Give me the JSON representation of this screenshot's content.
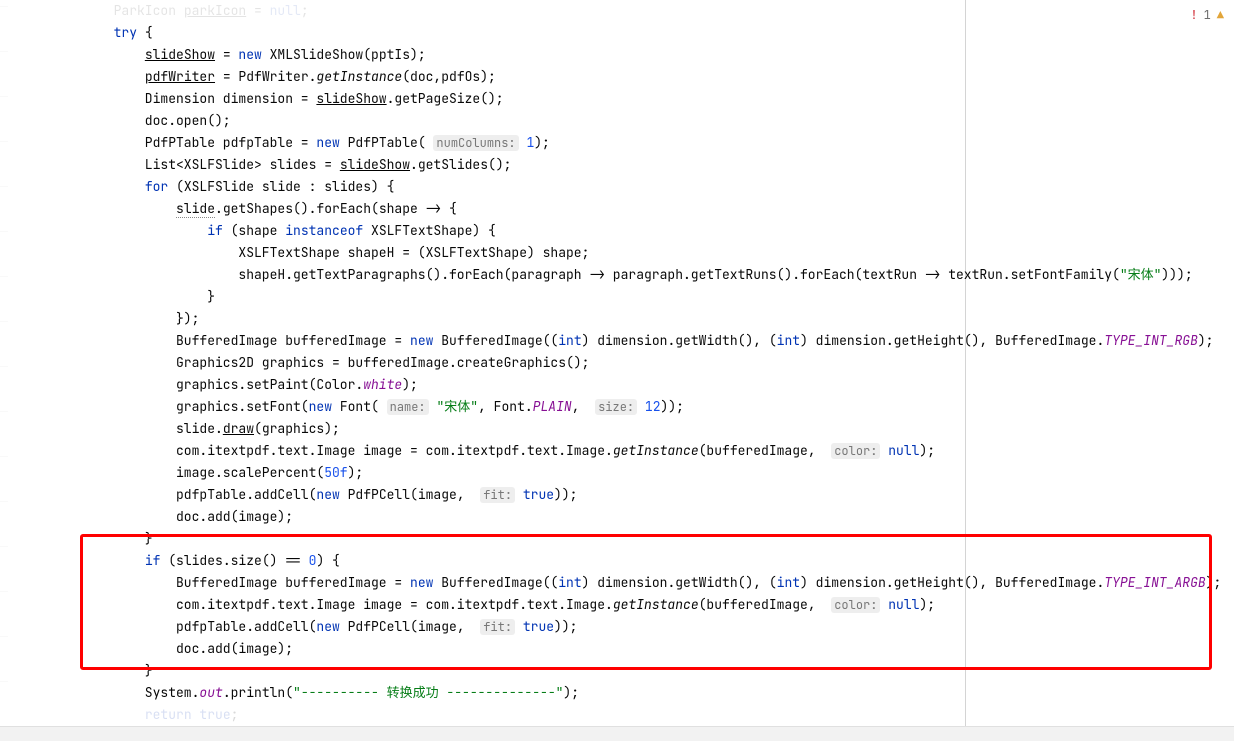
{
  "status": {
    "error_symbol": "!",
    "error_count": "1",
    "warn_symbol": "▲"
  },
  "code": {
    "l0a": "            ParkIcon ",
    "l0b": "parkIcon",
    "l0c": " = ",
    "l0d": "null",
    "l0e": ";",
    "l1a": "            ",
    "l1b": "try",
    "l1c": " {",
    "l2a": "                ",
    "l2b": "slideShow",
    "l2c": " = ",
    "l2d": "new",
    "l2e": " XMLSlideShow(pptIs);",
    "l3a": "                ",
    "l3b": "pdfWriter",
    "l3c": " = PdfWriter.",
    "l3d": "getInstance",
    "l3e": "(doc,pdfOs);",
    "l4a": "                Dimension dimension = ",
    "l4b": "slideShow",
    "l4c": ".getPageSize();",
    "l5a": "                doc.open();",
    "l6a": "                PdfPTable pdfpTable = ",
    "l6b": "new",
    "l6c": " PdfPTable( ",
    "l6d": "numColumns:",
    "l6e": " ",
    "l6f": "1",
    "l6g": ");",
    "l7a": "                List<XSLFSlide> slides = ",
    "l7b": "slideShow",
    "l7c": ".getSlides();",
    "l8a": "                ",
    "l8b": "for",
    "l8c": " (XSLFSlide slide : slides) {",
    "l9a": "                    ",
    "l9b": "slide",
    "l9c": ".getShapes().forEach(shape -> {",
    "l10a": "                        ",
    "l10b": "if",
    "l10c": " (shape ",
    "l10d": "instanceof",
    "l10e": " XSLFTextShape) {",
    "l11a": "                            XSLFTextShape shapeH = (XSLFTextShape) shape;",
    "l12a": "                            shapeH.getTextParagraphs().forEach(paragraph -> paragraph.getTextRuns().forEach(textRun -> textRun.setFontFamily(",
    "l12b": "\"宋体\"",
    "l12c": ")));",
    "l13a": "                        }",
    "l14a": "                    });",
    "l15a": "                    BufferedImage bufferedImage = ",
    "l15b": "new",
    "l15c": " BufferedImage((",
    "l15d": "int",
    "l15e": ") dimension.getWidth(), (",
    "l15f": "int",
    "l15g": ") dimension.getHeight(), BufferedImage.",
    "l15h": "TYPE_INT_RGB",
    "l15i": ");",
    "l16a": "                    Graphics2D graphics = bufferedImage.createGraphics();",
    "l17a": "                    graphics.setPaint(Color.",
    "l17b": "white",
    "l17c": ");",
    "l18a": "                    graphics.setFont(",
    "l18b": "new",
    "l18c": " Font( ",
    "l18d": "name:",
    "l18e": " ",
    "l18f": "\"宋体\"",
    "l18g": ", Font.",
    "l18h": "PLAIN",
    "l18i": ",  ",
    "l18j": "size:",
    "l18k": " ",
    "l18l": "12",
    "l18m": "));",
    "l19a": "                    slide.",
    "l19b": "draw",
    "l19c": "(graphics);",
    "l20a": "                    com.itextpdf.text.Image image = com.itextpdf.text.Image.",
    "l20b": "getInstance",
    "l20c": "(bufferedImage,  ",
    "l20d": "color:",
    "l20e": " ",
    "l20f": "null",
    "l20g": ");",
    "l21a": "                    image.scalePercent(",
    "l21b": "50f",
    "l21c": ");",
    "l22a": "                    pdfpTable.addCell(",
    "l22b": "new",
    "l22c": " PdfPCell(image,  ",
    "l22d": "fit:",
    "l22e": " ",
    "l22f": "true",
    "l22g": "));",
    "l23a": "                    doc.add(image);",
    "l24a": "                }",
    "l25a": "                ",
    "l25b": "if",
    "l25c": " (slides.size() == ",
    "l25d": "0",
    "l25e": ") {",
    "l26a": "                    BufferedImage bufferedImage = ",
    "l26b": "new",
    "l26c": " BufferedImage((",
    "l26d": "int",
    "l26e": ") dimension.getWidth(), (",
    "l26f": "int",
    "l26g": ") dimension.getHeight(), BufferedImage.",
    "l26h": "TYPE_INT_ARGB",
    "l26i": ");",
    "l27a": "                    com.itextpdf.text.Image image = com.itextpdf.text.Image.",
    "l27b": "getInstance",
    "l27c": "(bufferedImage,  ",
    "l27d": "color:",
    "l27e": " ",
    "l27f": "null",
    "l27g": ");",
    "l28a": "                    pdfpTable.addCell(",
    "l28b": "new",
    "l28c": " PdfPCell(image,  ",
    "l28d": "fit:",
    "l28e": " ",
    "l28f": "true",
    "l28g": "));",
    "l29a": "                    doc.add(image);",
    "l30a": "                }",
    "l31a": "                System.",
    "l31b": "out",
    "l31c": ".println(",
    "l31d": "\"---------- 转换成功 --------------\"",
    "l31e": ");",
    "l32a": "                ",
    "l32b": "return true",
    "l32c": ";"
  }
}
